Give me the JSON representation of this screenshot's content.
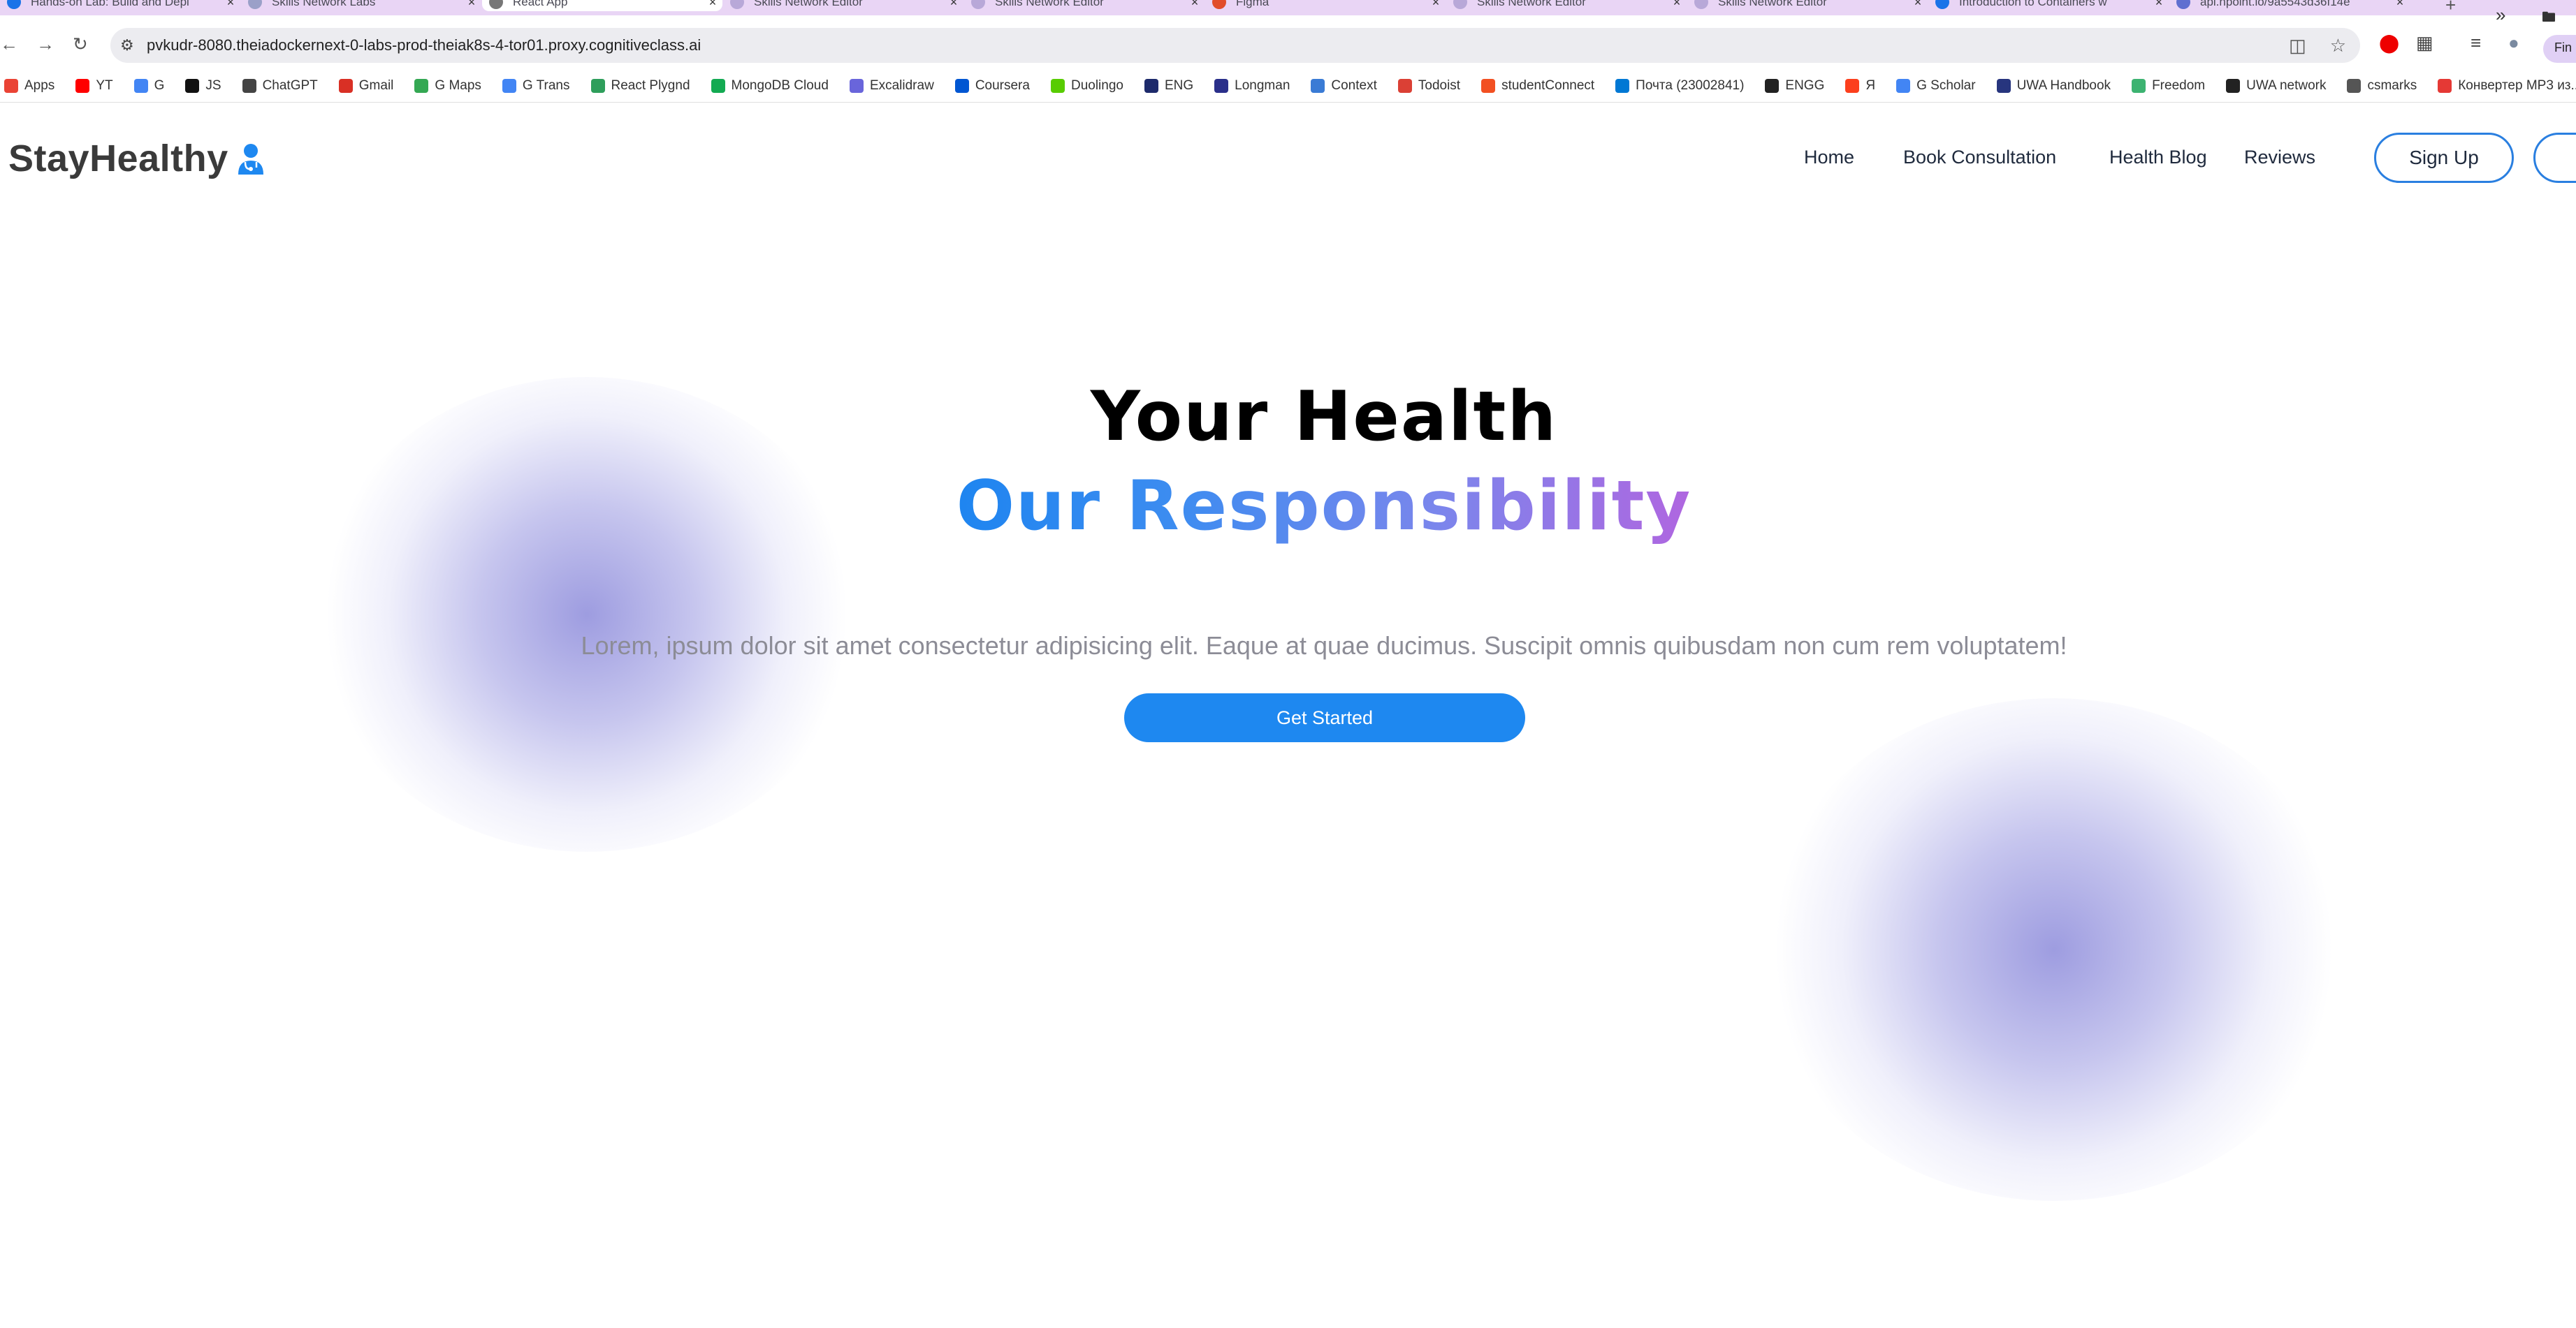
{
  "browser": {
    "tabs": [
      {
        "title": "Hands-on Lab: Build and Depl",
        "favicon_color": "#1a73e8",
        "active": false
      },
      {
        "title": "Skills Network Labs",
        "favicon_color": "#9aa0c8",
        "active": false
      },
      {
        "title": "React App",
        "favicon_color": "#777777",
        "active": true
      },
      {
        "title": "Skills Network Editor",
        "favicon_color": "#b8a8d8",
        "active": false
      },
      {
        "title": "Skills Network Editor",
        "favicon_color": "#b8a8d8",
        "active": false
      },
      {
        "title": "Figma",
        "favicon_color": "#e14d2a",
        "active": false
      },
      {
        "title": "Skills Network Editor",
        "favicon_color": "#b8a8d8",
        "active": false
      },
      {
        "title": "Skills Network Editor",
        "favicon_color": "#b8a8d8",
        "active": false
      },
      {
        "title": "Introduction to Containers w",
        "favicon_color": "#1a73e8",
        "active": false
      },
      {
        "title": "api.npoint.io/9a5543d36f14e",
        "favicon_color": "#5f6fd0",
        "active": false
      }
    ],
    "url": "pvkudr-8080.theiadockernext-0-labs-prod-theiak8s-4-tor01.proxy.cognitiveclass.ai",
    "find_label": "Fin",
    "bookmarks": [
      {
        "label": "Apps",
        "color": "#ea4335"
      },
      {
        "label": "YT",
        "color": "#ff0000"
      },
      {
        "label": "G",
        "color": "#4285f4"
      },
      {
        "label": "JS",
        "color": "#111111"
      },
      {
        "label": "ChatGPT",
        "color": "#444444"
      },
      {
        "label": "Gmail",
        "color": "#d93025"
      },
      {
        "label": "G Maps",
        "color": "#34a853"
      },
      {
        "label": "G Trans",
        "color": "#4285f4"
      },
      {
        "label": "React Plygnd",
        "color": "#2e9e5b"
      },
      {
        "label": "MongoDB Cloud",
        "color": "#13aa52"
      },
      {
        "label": "Excalidraw",
        "color": "#6965db"
      },
      {
        "label": "Coursera",
        "color": "#0056d2"
      },
      {
        "label": "Duolingo",
        "color": "#58cc02"
      },
      {
        "label": "ENG",
        "color": "#1d2a6b"
      },
      {
        "label": "Longman",
        "color": "#2a2f8a"
      },
      {
        "label": "Context",
        "color": "#3a7bd5"
      },
      {
        "label": "Todoist",
        "color": "#db4035"
      },
      {
        "label": "studentConnect",
        "color": "#f25022"
      },
      {
        "label": "Почта (23002841)",
        "color": "#0078d4"
      },
      {
        "label": "ENGG",
        "color": "#222222"
      },
      {
        "label": "Я",
        "color": "#fc3f1d"
      },
      {
        "label": "G Scholar",
        "color": "#4285f4"
      },
      {
        "label": "UWA Handbook",
        "color": "#27357e"
      },
      {
        "label": "Freedom",
        "color": "#3cb371"
      },
      {
        "label": "UWA network",
        "color": "#222222"
      },
      {
        "label": "csmarks",
        "color": "#555555"
      },
      {
        "label": "Конвертер MP3 из...",
        "color": "#e53935"
      }
    ]
  },
  "site": {
    "logo_text": "StayHealthy",
    "nav": [
      "Home",
      "Book Consultation",
      "Health Blog",
      "Reviews"
    ],
    "signup_label": "Sign Up",
    "hero": {
      "line1": "Your Health",
      "line2": "Our Responsibility",
      "lead": "Lorem, ipsum dolor sit amet consectetur adipisicing elit. Eaque at quae ducimus. Suscipit omnis quibusdam non cum rem voluptatem!",
      "cta": "Get Started"
    },
    "colors": {
      "accent": "#1e88f0",
      "gradient_end": "#b066e0",
      "blob": "#6a68cf"
    }
  }
}
